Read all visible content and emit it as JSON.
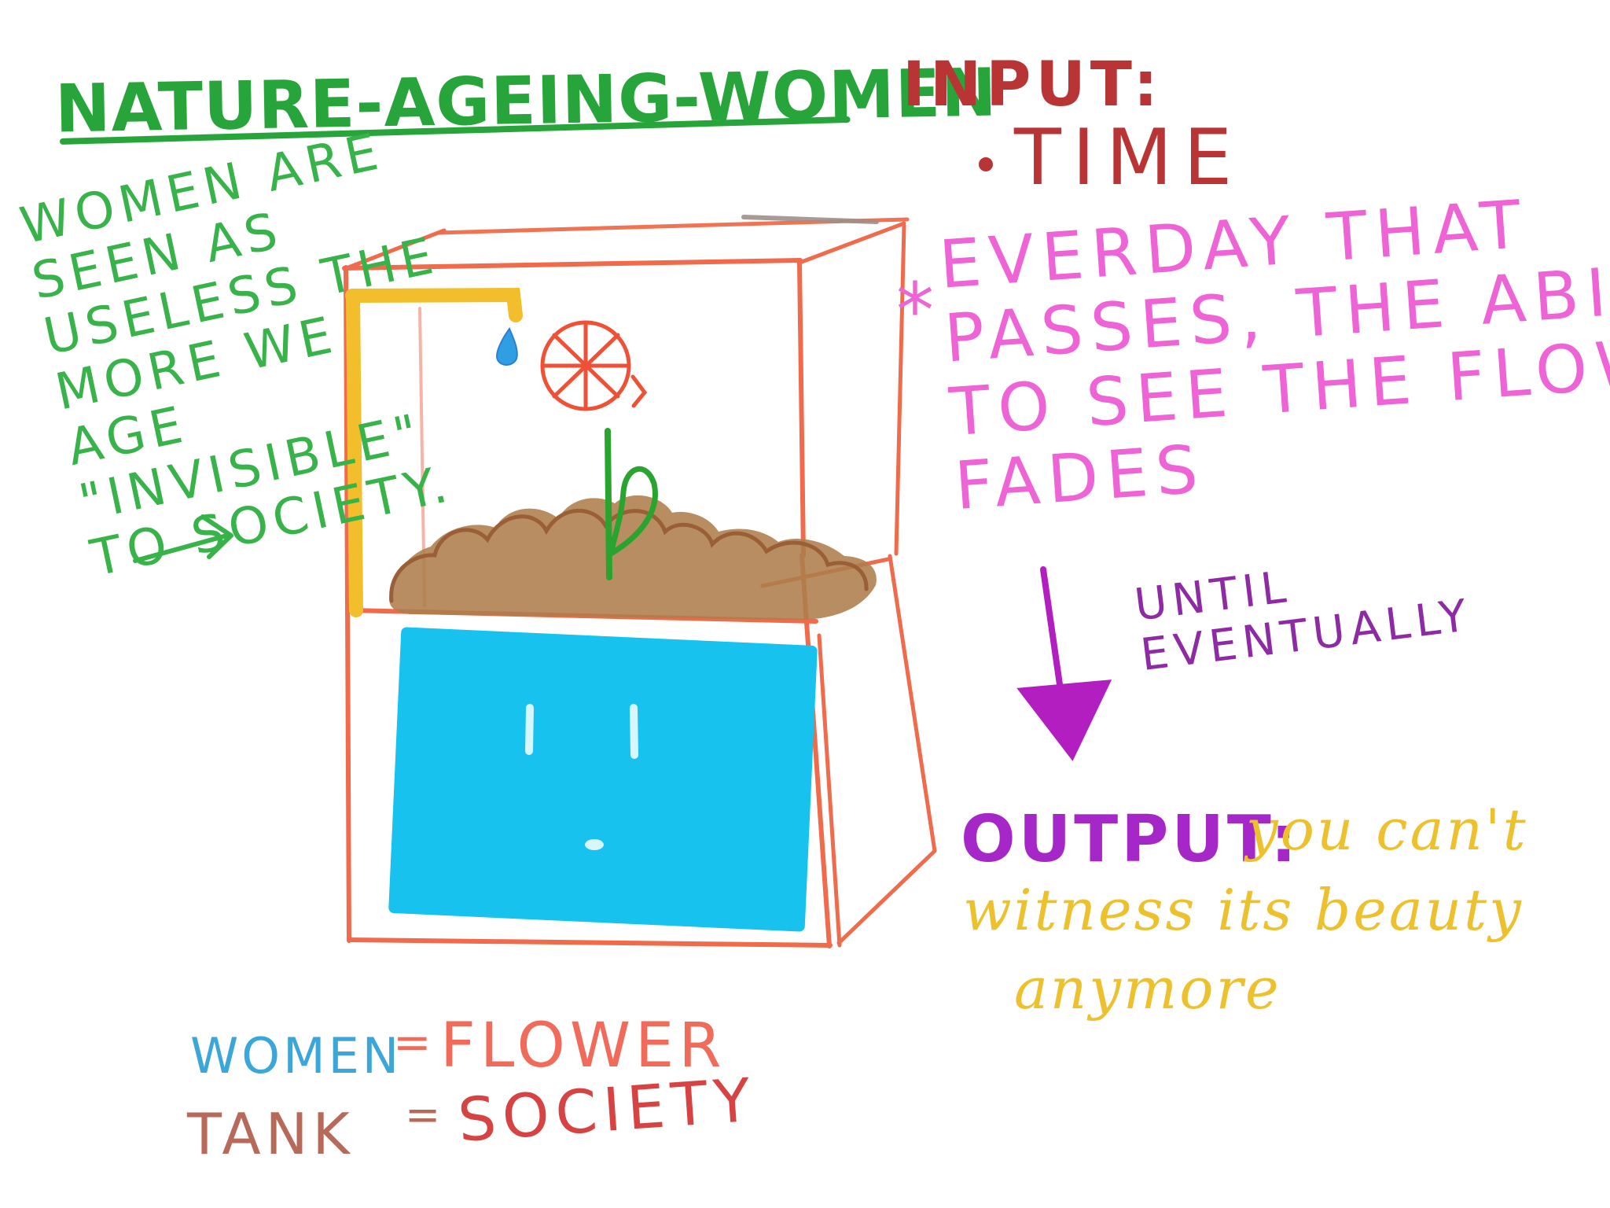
{
  "title": "NATURE-AGEING-WOMEN",
  "input": {
    "label": "INPUT:",
    "items": [
      "TIME"
    ]
  },
  "left_note": {
    "lines": [
      "WOMEN ARE",
      "SEEN AS",
      "USELESS THE",
      "MORE WE",
      "AGE",
      "\"INVISIBLE\"",
      "TO SOCIETY."
    ]
  },
  "pink_note": {
    "marker": "*",
    "lines": [
      "EVERDAY THAT",
      "PASSES, THE ABILITY",
      "TO SEE THE FLOWER",
      "FADES"
    ]
  },
  "until_note": {
    "lines": [
      "UNTIL",
      "EVENTUALLY"
    ]
  },
  "output": {
    "label": "OUTPUT:",
    "text_lines": [
      "you can't",
      "witness its beauty",
      "anymore"
    ]
  },
  "legend": {
    "women": "WOMEN",
    "equal_1": "=",
    "flower": "FLOWER",
    "tank": "TANK",
    "equal_2": "=",
    "society": "SOCIETY"
  },
  "colors": {
    "title": "#27a53a",
    "input": "#b93434",
    "left_note": "#37b34a",
    "pink_note": "#ee63d6",
    "until_note": "#8d2aa4",
    "output_label": "#a627c8",
    "output_text": "#edc12d",
    "women": "#3ba7d9",
    "flower": "#f16b5a",
    "tank": "#b86a5a",
    "society": "#d74343",
    "box_outline": "#ef5a3b",
    "water": "#17c2ef",
    "soil": "#a97845",
    "stem": "#29a52f",
    "pipe": "#f2be2b"
  },
  "icons": {
    "tank": "tank-diagram-icon",
    "arrow_left": "arrow-right-icon",
    "arrow_down": "arrow-down-icon",
    "flower": "flower-icon",
    "water_drop": "water-drop-icon",
    "pipe": "pipe-icon"
  }
}
